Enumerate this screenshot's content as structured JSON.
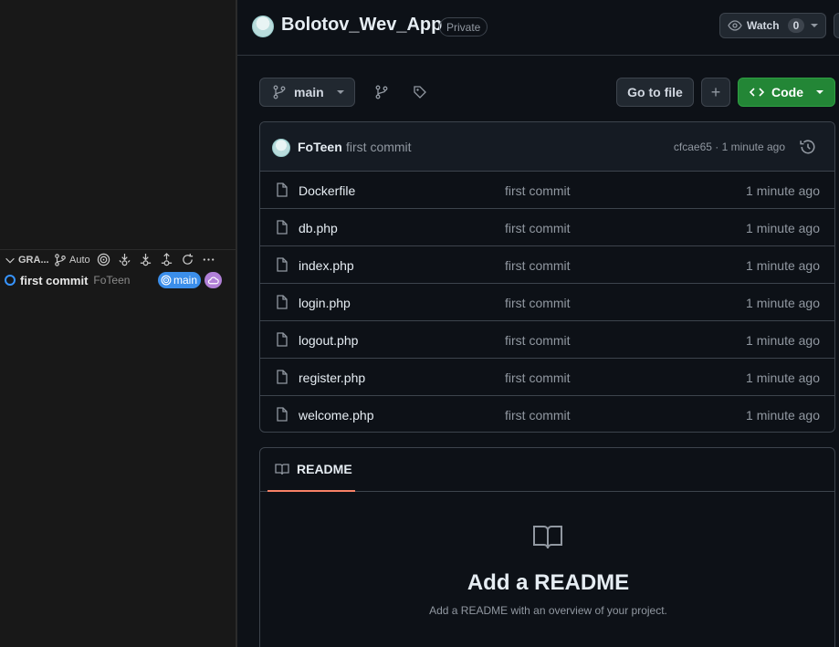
{
  "vscode": {
    "graph_title": "GRA...",
    "auto_label": "Auto",
    "commit": {
      "message": "first commit",
      "author": "FoTeen",
      "branch": "main"
    },
    "colors": {
      "branch_pill": "#3b8eea",
      "cloud_pill": "#b180d7",
      "commit_circle": "#3794ff"
    }
  },
  "repo": {
    "name": "Bolotov_Wev_App",
    "visibility": "Private",
    "watch_label": "Watch",
    "watch_count": "0"
  },
  "toolbar": {
    "branch": "main",
    "go_to_file": "Go to file",
    "plus": "+",
    "code": "Code"
  },
  "latest_commit": {
    "author": "FoTeen",
    "message": "first commit",
    "meta": "cfcae65 · 1 minute ago"
  },
  "files": [
    {
      "name": "Dockerfile",
      "commit": "first commit",
      "time": "1 minute ago"
    },
    {
      "name": "db.php",
      "commit": "first commit",
      "time": "1 minute ago"
    },
    {
      "name": "index.php",
      "commit": "first commit",
      "time": "1 minute ago"
    },
    {
      "name": "login.php",
      "commit": "first commit",
      "time": "1 minute ago"
    },
    {
      "name": "logout.php",
      "commit": "first commit",
      "time": "1 minute ago"
    },
    {
      "name": "register.php",
      "commit": "first commit",
      "time": "1 minute ago"
    },
    {
      "name": "welcome.php",
      "commit": "first commit",
      "time": "1 minute ago"
    }
  ],
  "readme": {
    "tab_label": "README",
    "title": "Add a README",
    "subtitle": "Add a README with an overview of your project."
  },
  "theme": {
    "accent_green": "#238636",
    "tab_underline": "#f78166",
    "bg": "#0d1117"
  }
}
